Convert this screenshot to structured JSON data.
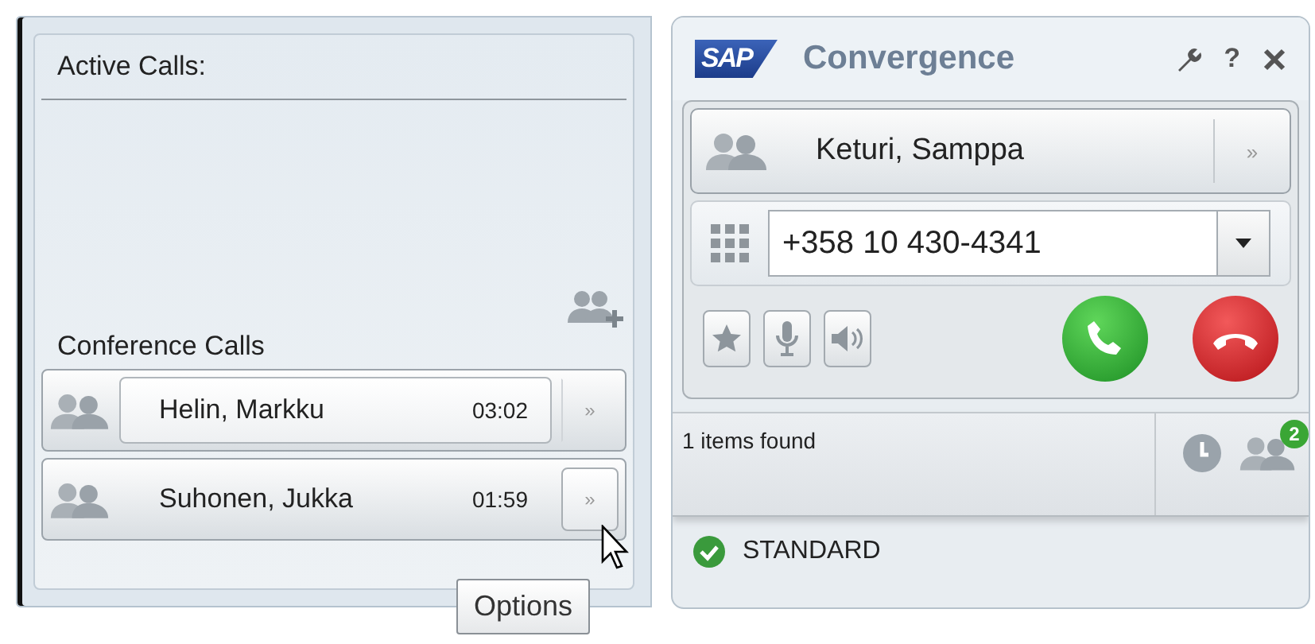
{
  "calls_panel": {
    "title": "Active Calls:",
    "conference_label": "Conference Calls",
    "conference_calls": [
      {
        "name": "Helin, Markku",
        "duration": "03:02",
        "selected": true,
        "options_label": "»",
        "options_hovered": false
      },
      {
        "name": "Suhonen, Jukka",
        "duration": "01:59",
        "selected": false,
        "options_label": "»",
        "options_hovered": true
      }
    ]
  },
  "tooltip": {
    "text": "Options"
  },
  "phone_panel": {
    "logo": "SAP",
    "title": "Convergence",
    "help": "?",
    "contact": {
      "name": "Keturi, Samppa",
      "options_label": "»"
    },
    "number_field": {
      "value": "+358 10 430-4341"
    },
    "status": {
      "text": "1 items found",
      "badge": "2"
    },
    "presence": {
      "text": "STANDARD"
    }
  }
}
